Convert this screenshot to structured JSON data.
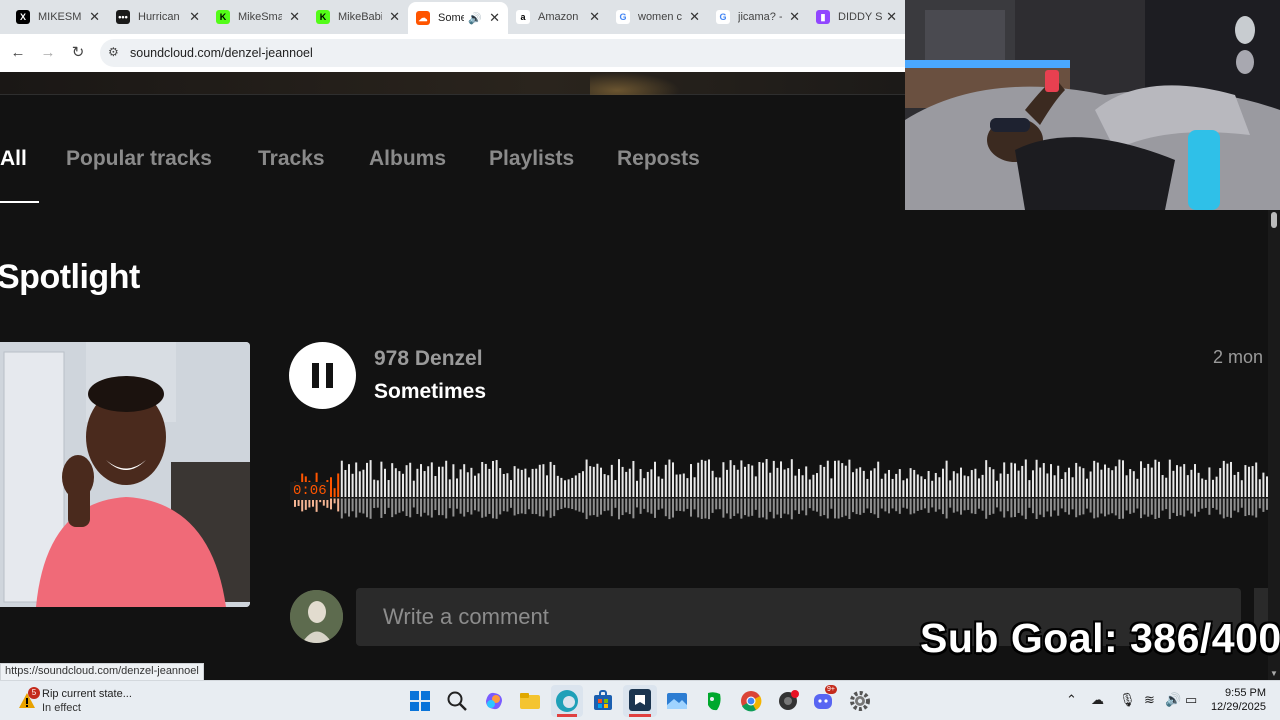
{
  "browser": {
    "tabs": [
      {
        "label": "MIKESM",
        "icon": "x-icon",
        "color": "#000000",
        "active": false
      },
      {
        "label": "Hurrican",
        "icon": "dots-icon",
        "color": "#1a1a1a",
        "active": false
      },
      {
        "label": "MikeSma",
        "icon": "kick-icon",
        "color": "#53fc18",
        "active": false
      },
      {
        "label": "MikeBabi",
        "icon": "kick-icon",
        "color": "#53fc18",
        "active": false
      },
      {
        "label": "Some",
        "icon": "soundcloud-icon",
        "color": "#ff5500",
        "active": true
      },
      {
        "label": "Amazon",
        "icon": "amazon-icon",
        "color": "#232f3e",
        "active": false
      },
      {
        "label": "women c",
        "icon": "google-icon",
        "color": "#4285f4",
        "active": false
      },
      {
        "label": "jicama? -",
        "icon": "google-icon",
        "color": "#4285f4",
        "active": false
      },
      {
        "label": "DIDDY S",
        "icon": "twitch-icon",
        "color": "#9146ff",
        "active": false
      }
    ],
    "url": "soundcloud.com/denzel-jeannoel",
    "status_url": "https://soundcloud.com/denzel-jeannoel"
  },
  "profile_nav": {
    "tabs": [
      "All",
      "Popular tracks",
      "Tracks",
      "Albums",
      "Playlists",
      "Reposts"
    ]
  },
  "section_title": "Spotlight",
  "player": {
    "artist": "978 Denzel",
    "track": "Sometimes",
    "posted": "2 mon",
    "elapsed": "0:06",
    "accent": "#ff5500"
  },
  "comment": {
    "placeholder": "Write a comment"
  },
  "overlay": {
    "sub_goal": "Sub Goal: 386/400"
  },
  "taskbar": {
    "notification_title": "Rip current state...",
    "notification_sub": "In effect",
    "notification_count": "5",
    "discord_badge": "9+",
    "time": "9:55 PM",
    "date": "12/29/2025"
  }
}
